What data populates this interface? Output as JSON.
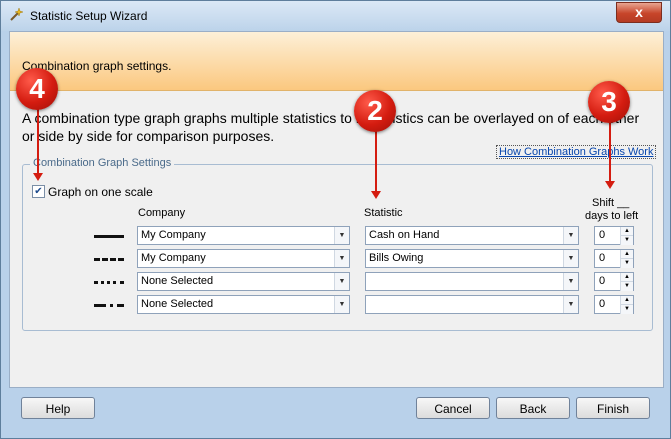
{
  "window": {
    "title": "Statistic Setup Wizard",
    "close_glyph": "x"
  },
  "banner": {
    "text": "Combination graph settings."
  },
  "description": "A combination type graph graphs multiple statistics to    r. Statistics can be overlayed on    of each other or side by side for comparison purposes.",
  "help_link": "How Combination Graphs Work",
  "group": {
    "legend": "Combination Graph Settings",
    "one_scale_label": "Graph on one scale",
    "one_scale_checked": true,
    "check_glyph": "✔",
    "col_company": "Company",
    "col_statistic": "Statistic",
    "col_shift_line1": "Shift __",
    "col_shift_line2": "days to left",
    "rows": [
      {
        "line_style": "solid",
        "company": "My Company",
        "statistic": "Cash on Hand",
        "shift": "0"
      },
      {
        "line_style": "dashed",
        "company": "My Company",
        "statistic": "Bills Owing",
        "shift": "0"
      },
      {
        "line_style": "dotted",
        "company": "None Selected",
        "statistic": "",
        "shift": "0"
      },
      {
        "line_style": "dash-dot",
        "company": "None Selected",
        "statistic": "",
        "shift": "0"
      }
    ]
  },
  "glyphs": {
    "dropdown": "▼",
    "spin_up": "▲",
    "spin_down": "▼"
  },
  "buttons": {
    "help": "Help",
    "cancel": "Cancel",
    "back": "Back",
    "finish": "Finish"
  },
  "callouts": [
    "4",
    "2",
    "3"
  ],
  "colors": {
    "banner": "#fbc87f",
    "callout": "#d41c10",
    "frame": "#b9d1ea",
    "link": "#0645ad"
  }
}
